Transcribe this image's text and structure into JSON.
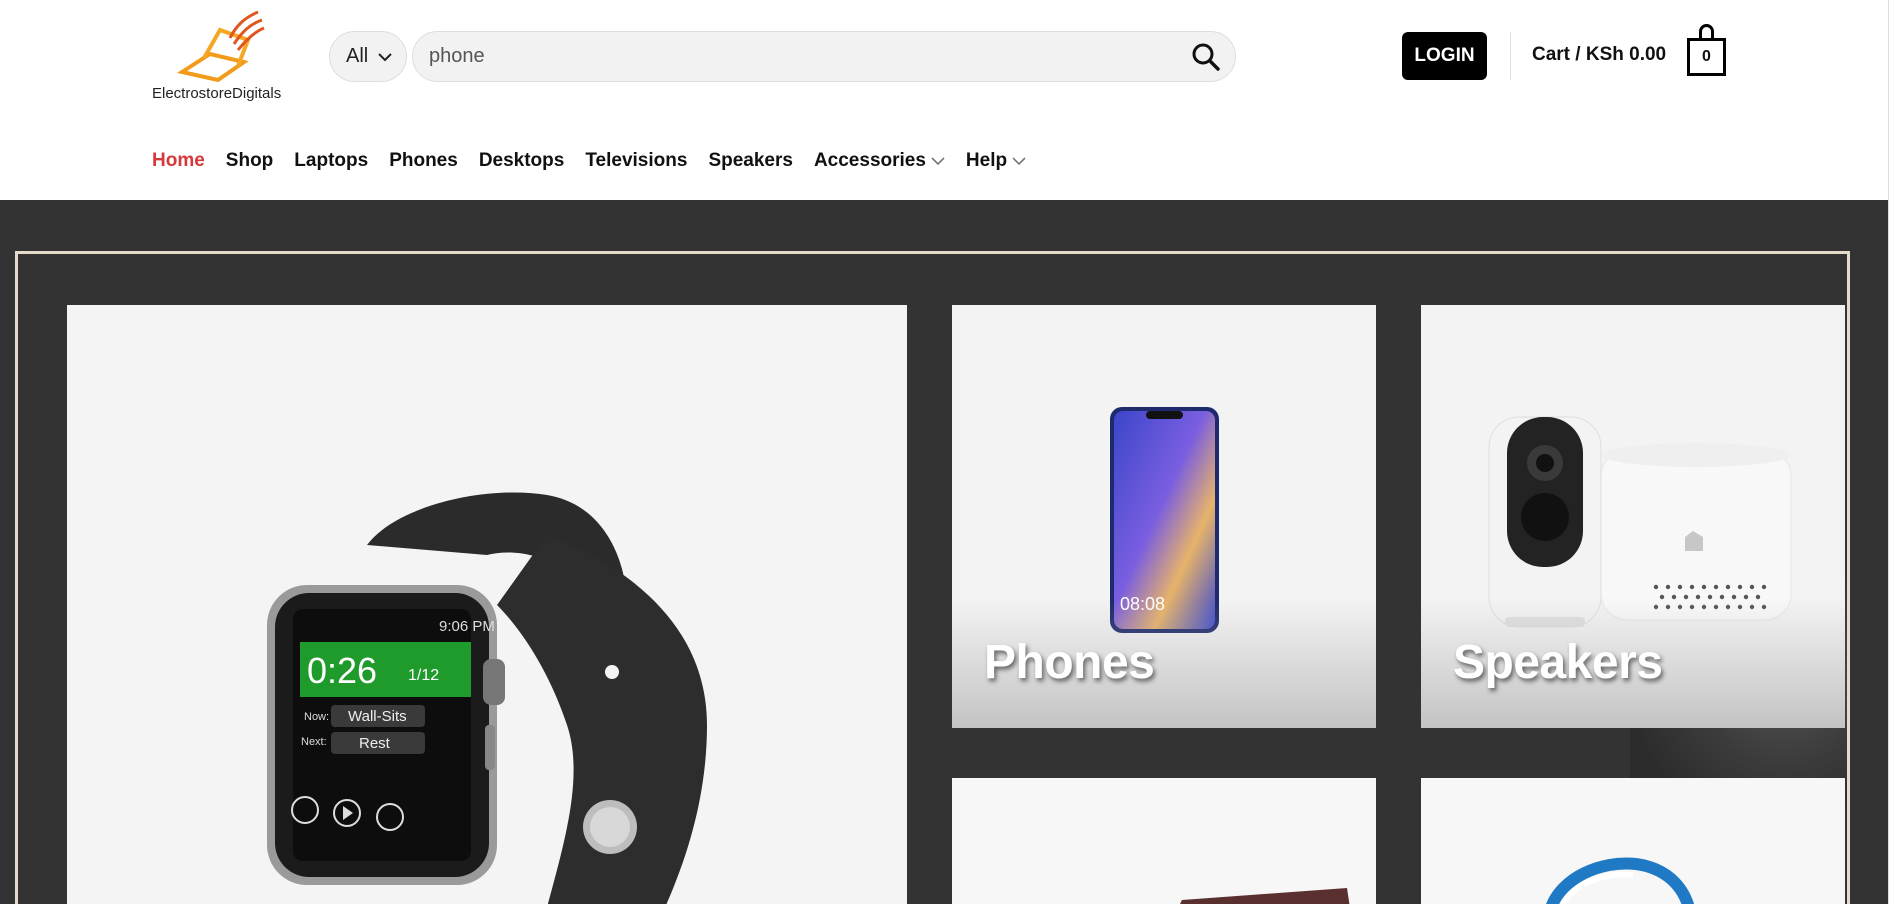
{
  "brand": {
    "name": "ElectrostoreDigitals",
    "logo_colors": [
      "#f29a1a",
      "#e0561f"
    ]
  },
  "search": {
    "category": "All",
    "value": "phone"
  },
  "account": {
    "login_label": "LOGIN"
  },
  "cart": {
    "label": "Cart / KSh 0.00",
    "count": "0"
  },
  "nav": {
    "items": [
      {
        "label": "Home",
        "active": true
      },
      {
        "label": "Shop"
      },
      {
        "label": "Laptops"
      },
      {
        "label": "Phones"
      },
      {
        "label": "Desktops"
      },
      {
        "label": "Televisions"
      },
      {
        "label": "Speakers"
      },
      {
        "label": "Accessories",
        "dropdown": true
      },
      {
        "label": "Help",
        "dropdown": true
      }
    ]
  },
  "hero": {
    "tiles": [
      {
        "label": ""
      },
      {
        "label": "Phones"
      },
      {
        "label": "Speakers"
      }
    ],
    "watch_screen": {
      "time": "9:06 PM",
      "timer": "0:26",
      "progress": "1/12",
      "now_label": "Now:",
      "now_value": "Wall-Sits",
      "next_label": "Next:",
      "next_value": "Rest"
    },
    "phone_screen_time": "08:08"
  },
  "colors": {
    "accent": "#d7383a",
    "dark_bg": "#333333",
    "frame": "#e4dcc8"
  }
}
